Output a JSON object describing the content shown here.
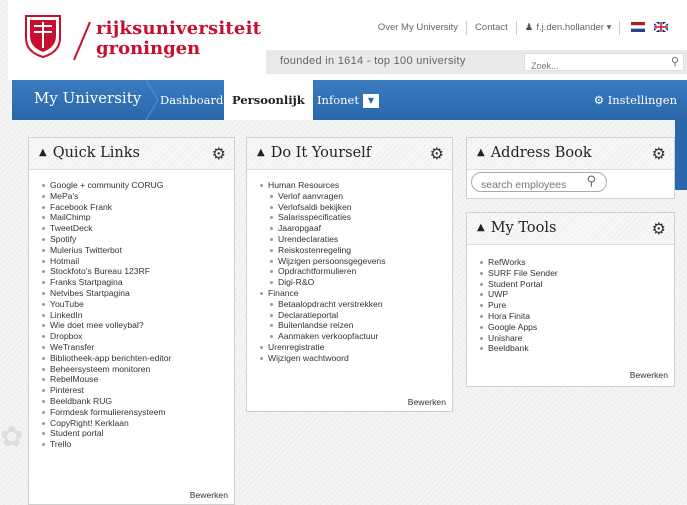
{
  "brand": {
    "line1": "rijksuniversiteit",
    "line2": "groningen",
    "tagline": "founded in 1614  -  top 100 university"
  },
  "top_links": {
    "about": "Over My University",
    "contact": "Contact",
    "user": "f.j.den.hollander"
  },
  "search": {
    "placeholder": "Zoek..."
  },
  "nav": {
    "title": "My University",
    "items": [
      "Dashboard",
      "Persoonlijk",
      "Infonet"
    ],
    "settings": "Instellingen"
  },
  "quick_links": {
    "title": "Quick Links",
    "items": [
      "Google + community CORUG",
      "MePa's",
      "Facebook Frank",
      "MailChimp",
      "TweetDeck",
      "Spotify",
      "Mulerius Twitterbot",
      "Hotmail",
      "Stockfoto's Bureau 123RF",
      "Franks Startpagina",
      "Netvibes Startpagina",
      "YouTube",
      "LinkedIn",
      "Wie doet mee volleybal?",
      "Dropbox",
      "WeTransfer",
      "Bibliotheek-app berichten-editor",
      "Beheersysteem monitoren",
      "RebelMouse",
      "Pinterest",
      "Beeldbank RUG",
      "Formdesk formulierensysteem",
      "CopyRight! Kerklaan",
      "Student portal",
      "Trello"
    ],
    "edit": "Bewerken"
  },
  "diy": {
    "title": "Do It Yourself",
    "items": [
      {
        "label": "Human Resources",
        "level": 0
      },
      {
        "label": "Verlof aanvragen",
        "level": 1
      },
      {
        "label": "Verlofsaldi bekijken",
        "level": 1
      },
      {
        "label": "Salarisspecificaties",
        "level": 1
      },
      {
        "label": "Jaaropgaaf",
        "level": 1
      },
      {
        "label": "Urendeclaraties",
        "level": 1
      },
      {
        "label": "Reiskostenregeling",
        "level": 1
      },
      {
        "label": "Wijzigen persoonsgegevens",
        "level": 1
      },
      {
        "label": "Opdrachtformulieren",
        "level": 1
      },
      {
        "label": "Digi-R&O",
        "level": 1
      },
      {
        "label": "Finance",
        "level": 0
      },
      {
        "label": "Betaalopdracht verstrekken",
        "level": 1
      },
      {
        "label": "Declaratieportal",
        "level": 1
      },
      {
        "label": "Buitenlandse reizen",
        "level": 1
      },
      {
        "label": "Aanmaken verkoopfactuur",
        "level": 1
      },
      {
        "label": "Urenregistratie",
        "level": 0
      },
      {
        "label": "Wijzigen wachtwoord",
        "level": 0
      }
    ],
    "edit": "Bewerken"
  },
  "address_book": {
    "title": "Address Book",
    "placeholder": "search employees"
  },
  "my_tools": {
    "title": "My Tools",
    "items": [
      "RefWorks",
      "SURF File Sender",
      "Student Portal",
      "UWP",
      "Pure",
      "Hora Finita",
      "Google Apps",
      "Unishare",
      "Beeldbank"
    ],
    "edit": "Bewerken"
  },
  "colors": {
    "brand_red": "#c8102e",
    "nav_blue": "#2a67ab"
  }
}
